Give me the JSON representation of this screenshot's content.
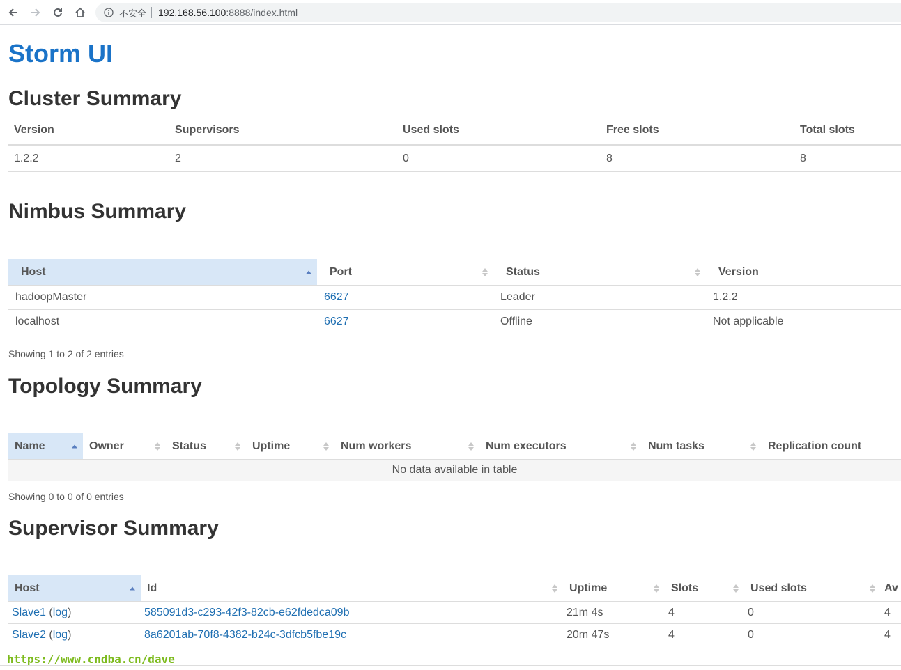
{
  "browser": {
    "insecure_label": "不安全",
    "url_host": "192.168.56.100",
    "url_path": ":8888/index.html"
  },
  "page": {
    "title": "Storm UI"
  },
  "cluster": {
    "heading": "Cluster Summary",
    "columns": [
      "Version",
      "Supervisors",
      "Used slots",
      "Free slots",
      "Total slots"
    ],
    "row": [
      "1.2.2",
      "2",
      "0",
      "8",
      "8"
    ]
  },
  "nimbus": {
    "heading": "Nimbus Summary",
    "columns": [
      "Host",
      "Port",
      "Status",
      "Version"
    ],
    "rows": [
      [
        "hadoopMaster",
        "6627",
        "Leader",
        "1.2.2"
      ],
      [
        "localhost",
        "6627",
        "Offline",
        "Not applicable"
      ]
    ],
    "info": "Showing 1 to 2 of 2 entries"
  },
  "topology": {
    "heading": "Topology Summary",
    "columns": [
      "Name",
      "Owner",
      "Status",
      "Uptime",
      "Num workers",
      "Num executors",
      "Num tasks",
      "Replication count"
    ],
    "empty": "No data available in table",
    "info": "Showing 0 to 0 of 0 entries"
  },
  "supervisor": {
    "heading": "Supervisor Summary",
    "columns": [
      "Host",
      "Id",
      "Uptime",
      "Slots",
      "Used slots",
      "Av"
    ],
    "rows": [
      {
        "host": "Slave1",
        "log": "log",
        "id": "585091d3-c293-42f3-82cb-e62fdedca09b",
        "uptime": "21m 4s",
        "slots": "4",
        "used": "0",
        "avail": "4"
      },
      {
        "host": "Slave2",
        "log": "log",
        "id": "8a6201ab-70f8-4382-b24c-3dfcb5fbe19c",
        "uptime": "20m 47s",
        "slots": "4",
        "used": "0",
        "avail": "4"
      }
    ]
  },
  "watermark": "https://www.cndba.cn/dave"
}
